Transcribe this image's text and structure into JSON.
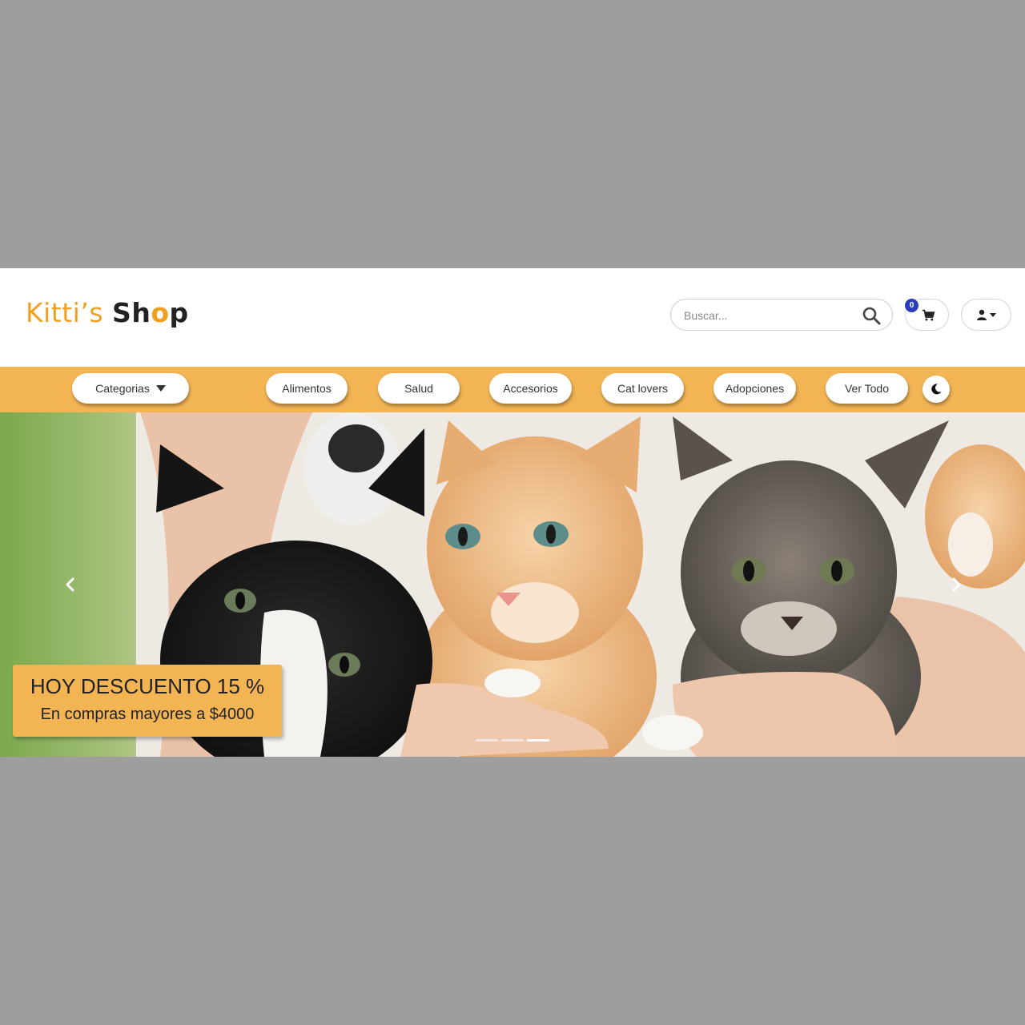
{
  "brand": {
    "part1": "Kitti’s",
    "part2a": "Sh",
    "part2b": "o",
    "part2c": "p"
  },
  "search": {
    "placeholder": "Buscar..."
  },
  "cart": {
    "count": "0"
  },
  "nav": {
    "categories": "Categorias",
    "items": [
      "Alimentos",
      "Salud",
      "Accesorios",
      "Cat lovers",
      "Adopciones",
      "Ver Todo"
    ]
  },
  "hero": {
    "promo_title": "HOY DESCUENTO 15 %",
    "promo_subtitle": "En compras mayores a $4000",
    "slides_total": 3,
    "active_slide": 3
  },
  "colors": {
    "accent": "#f3b554",
    "badge": "#2b3db8",
    "logo_orange": "#f0a020",
    "backdrop": "#9e9e9e"
  },
  "icons": [
    "search-icon",
    "cart-icon",
    "user-icon",
    "caret-down-icon",
    "moon-icon",
    "chevron-left-icon",
    "chevron-right-icon"
  ]
}
